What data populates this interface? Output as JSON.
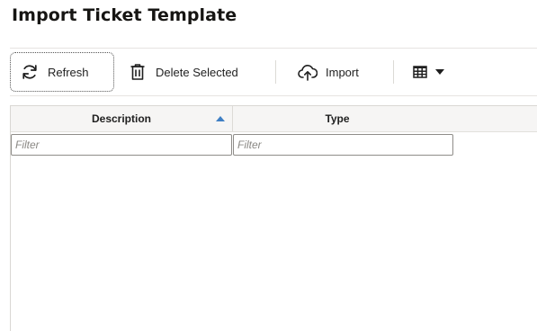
{
  "page": {
    "title": "Import Ticket Template"
  },
  "toolbar": {
    "refresh_label": "Refresh",
    "delete_label": "Delete Selected",
    "import_label": "Import",
    "refresh_icon": "refresh-icon",
    "delete_icon": "trash-icon",
    "import_icon": "cloud-upload-icon",
    "columns_icon": "table-grid-icon"
  },
  "grid": {
    "columns": [
      {
        "label": "Description",
        "sort": "ascending"
      },
      {
        "label": "Type"
      }
    ],
    "filters": [
      {
        "placeholder": "Filter",
        "value": ""
      },
      {
        "placeholder": "Filter",
        "value": ""
      }
    ],
    "rows": []
  },
  "colors": {
    "accent": "#3f7fc4",
    "title": "#161513",
    "header_bg": "#f6f5f4"
  }
}
